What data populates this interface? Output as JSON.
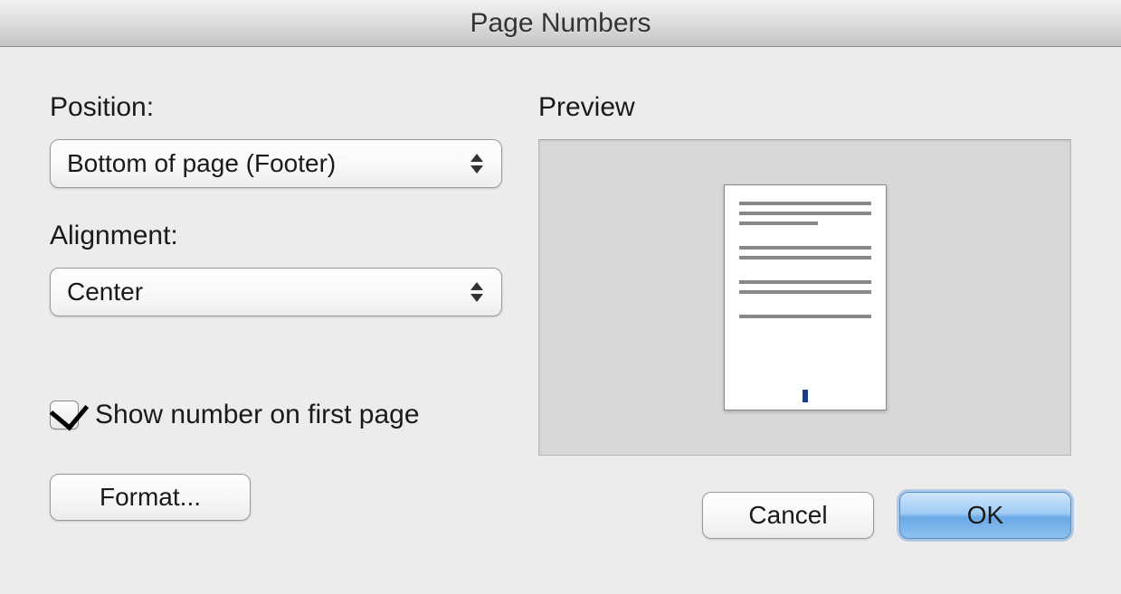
{
  "window": {
    "title": "Page Numbers"
  },
  "position": {
    "label": "Position:",
    "value": "Bottom of page (Footer)"
  },
  "alignment": {
    "label": "Alignment:",
    "value": "Center"
  },
  "checkbox": {
    "label": "Show number on first page",
    "checked": true
  },
  "preview": {
    "label": "Preview"
  },
  "buttons": {
    "format": "Format...",
    "cancel": "Cancel",
    "ok": "OK"
  }
}
